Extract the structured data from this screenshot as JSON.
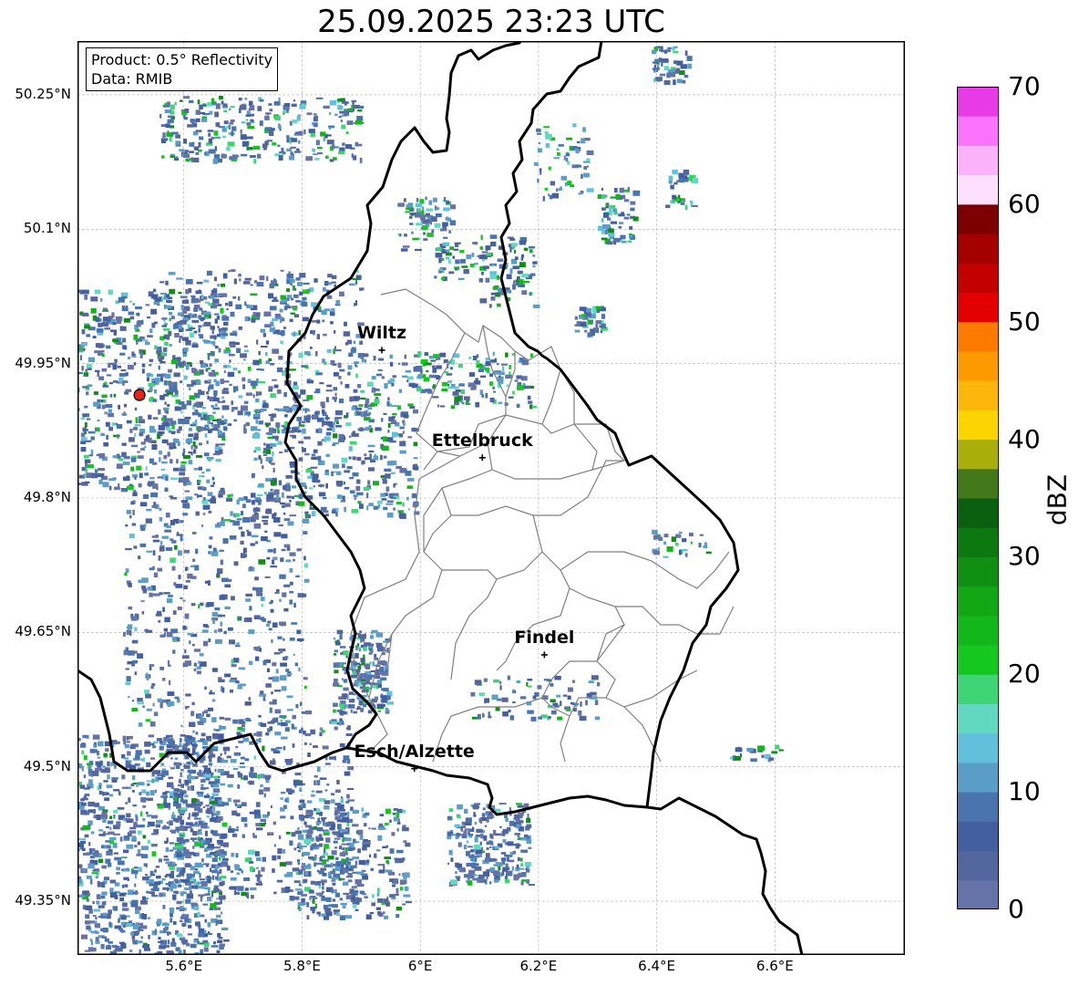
{
  "title": "25.09.2025 23:23 UTC",
  "info": {
    "product": "Product: 0.5° Reflectivity",
    "data": "Data: RMIB"
  },
  "map": {
    "lon_range": [
      5.42,
      6.82
    ],
    "lat_range": [
      49.29,
      50.31
    ],
    "lat_ticks": [
      {
        "value": 50.25,
        "label": "50.25°N"
      },
      {
        "value": 50.1,
        "label": "50.1°N"
      },
      {
        "value": 49.95,
        "label": "49.95°N"
      },
      {
        "value": 49.8,
        "label": "49.8°N"
      },
      {
        "value": 49.65,
        "label": "49.65°N"
      },
      {
        "value": 49.5,
        "label": "49.5°N"
      },
      {
        "value": 49.35,
        "label": "49.35°N"
      }
    ],
    "lon_ticks": [
      {
        "value": 5.6,
        "label": "5.6°E"
      },
      {
        "value": 5.8,
        "label": "5.8°E"
      },
      {
        "value": 6.0,
        "label": "6°E"
      },
      {
        "value": 6.2,
        "label": "6.2°E"
      },
      {
        "value": 6.4,
        "label": "6.4°E"
      },
      {
        "value": 6.6,
        "label": "6.6°E"
      }
    ],
    "grid": true,
    "radar_site": {
      "lon": 5.525,
      "lat": 49.915,
      "color": "#e3241b"
    },
    "cities": [
      {
        "name": "Wiltz",
        "lon": 5.935,
        "lat": 49.965
      },
      {
        "name": "Ettelbruck",
        "lon": 6.105,
        "lat": 49.845
      },
      {
        "name": "Findel",
        "lon": 6.21,
        "lat": 49.625
      },
      {
        "name": "Esch/Alzette",
        "lon": 5.99,
        "lat": 49.498
      }
    ]
  },
  "colorbar": {
    "title": "dBZ",
    "min": 0,
    "max": 70,
    "tick_labels": [
      {
        "value": 0,
        "label": "0"
      },
      {
        "value": 10,
        "label": "10"
      },
      {
        "value": 20,
        "label": "20"
      },
      {
        "value": 30,
        "label": "30"
      },
      {
        "value": 40,
        "label": "40"
      },
      {
        "value": 50,
        "label": "50"
      },
      {
        "value": 60,
        "label": "60"
      },
      {
        "value": 70,
        "label": "70"
      }
    ],
    "colors": [
      "#6573a8",
      "#53669e",
      "#435fa0",
      "#4a74ad",
      "#5a9dc6",
      "#63c0dd",
      "#60d9c0",
      "#3fd475",
      "#14c81f",
      "#12b81a",
      "#10a614",
      "#0e8f12",
      "#0b7810",
      "#0a600e",
      "#42781a",
      "#a9ae0a",
      "#fcd500",
      "#fcb50a",
      "#fc9a00",
      "#fc7a00",
      "#e30000",
      "#c20000",
      "#a40000",
      "#7c0000",
      "#fde0fd",
      "#fbb2fb",
      "#fb72fb",
      "#e93ae8"
    ]
  }
}
